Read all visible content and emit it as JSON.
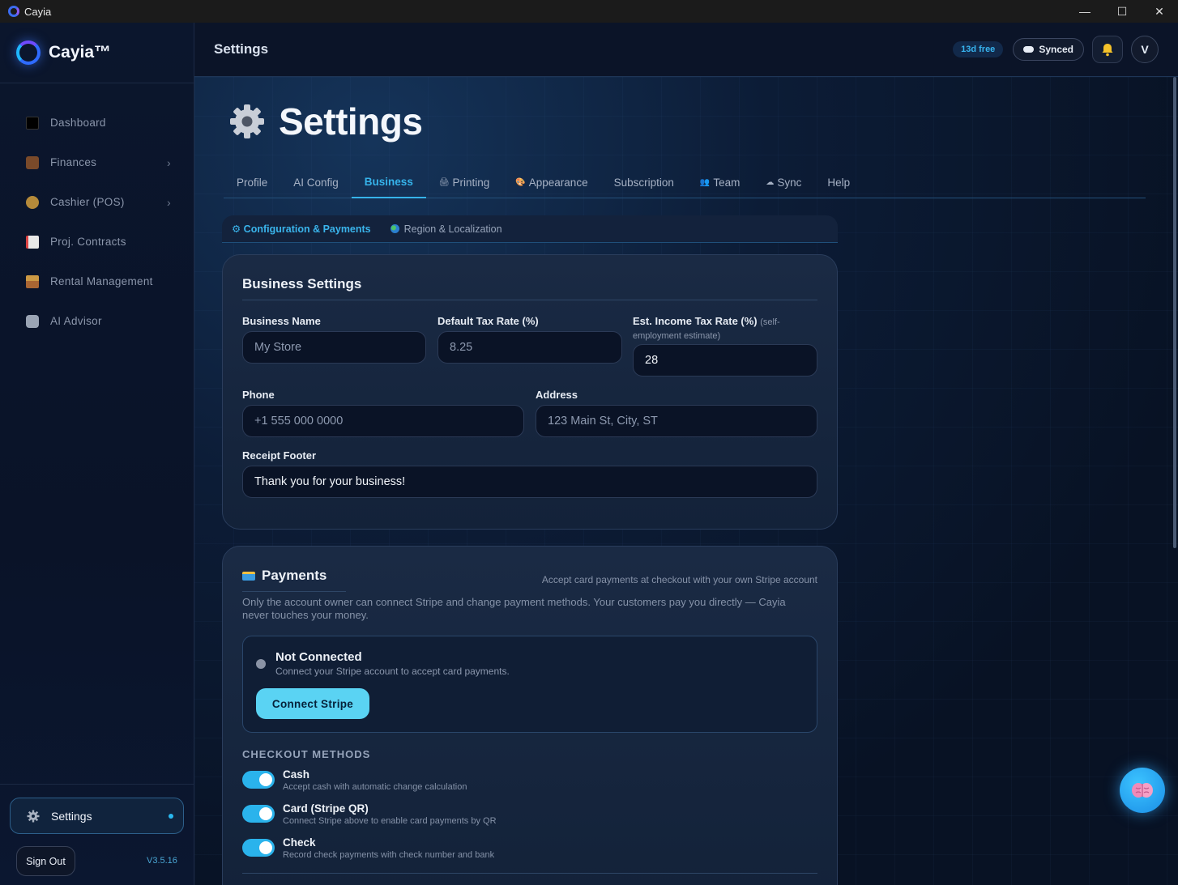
{
  "window": {
    "title": "Cayia",
    "controls": {
      "minimize": "—",
      "maximize": "☐",
      "close": "✕"
    }
  },
  "sidebar": {
    "brand": "Cayia™",
    "items": [
      {
        "label": "Dashboard",
        "icon": "dashboard-icon",
        "has_chevron": false
      },
      {
        "label": "Finances",
        "icon": "briefcase-icon",
        "has_chevron": true
      },
      {
        "label": "Cashier (POS)",
        "icon": "money-bag-icon",
        "has_chevron": true
      },
      {
        "label": "Proj. Contracts",
        "icon": "memo-icon",
        "has_chevron": false
      },
      {
        "label": "Rental Management",
        "icon": "house-icon",
        "has_chevron": false
      },
      {
        "label": "AI Advisor",
        "icon": "robot-icon",
        "has_chevron": false
      }
    ],
    "settings_label": "Settings",
    "sign_out": "Sign Out",
    "version": "V3.5.16"
  },
  "topbar": {
    "title": "Settings",
    "trial": "13d free",
    "sync_status": "Synced",
    "avatar_initial": "V"
  },
  "page": {
    "title": "Settings"
  },
  "tabs": [
    {
      "label": "Profile",
      "icon": ""
    },
    {
      "label": "AI Config",
      "icon": ""
    },
    {
      "label": "Business",
      "icon": "",
      "active": true
    },
    {
      "label": "Printing",
      "icon": "🖨"
    },
    {
      "label": "Appearance",
      "icon": "🎨"
    },
    {
      "label": "Subscription",
      "icon": ""
    },
    {
      "label": "Team",
      "icon": "👥"
    },
    {
      "label": "Sync",
      "icon": "☁"
    },
    {
      "label": "Help",
      "icon": ""
    }
  ],
  "subtabs": {
    "config": "⚙ Configuration & Payments",
    "region": "Region & Localization"
  },
  "business": {
    "title": "Business Settings",
    "name_label": "Business Name",
    "name_placeholder": "My Store",
    "tax_label": "Default Tax Rate (%)",
    "tax_placeholder": "8.25",
    "income_label": "Est. Income Tax Rate (%)",
    "income_note": "(self-employment estimate)",
    "income_value": "28",
    "phone_label": "Phone",
    "phone_placeholder": "+1 555 000 0000",
    "address_label": "Address",
    "address_placeholder": "123 Main St, City, ST",
    "footer_label": "Receipt Footer",
    "footer_value": "Thank you for your business!"
  },
  "payments": {
    "title": "Payments",
    "subtitle": "Accept card payments at checkout with your own Stripe account",
    "description": "Only the account owner can connect Stripe and change payment methods. Your customers pay you directly — Cayia never touches your money.",
    "status": "Not Connected",
    "status_sub": "Connect your Stripe account to accept card payments.",
    "connect_button": "Connect Stripe",
    "methods_title": "CHECKOUT METHODS",
    "methods": [
      {
        "name": "Cash",
        "desc": "Accept cash with automatic change calculation",
        "enabled": true
      },
      {
        "name": "Card (Stripe QR)",
        "desc": "Connect Stripe above to enable card payments by QR",
        "enabled": true
      },
      {
        "name": "Check",
        "desc": "Record check payments with check number and bank",
        "enabled": true
      }
    ]
  },
  "colors": {
    "accent": "#36b3ea",
    "button": "#5ad3f3",
    "bg": "#0a1226"
  }
}
